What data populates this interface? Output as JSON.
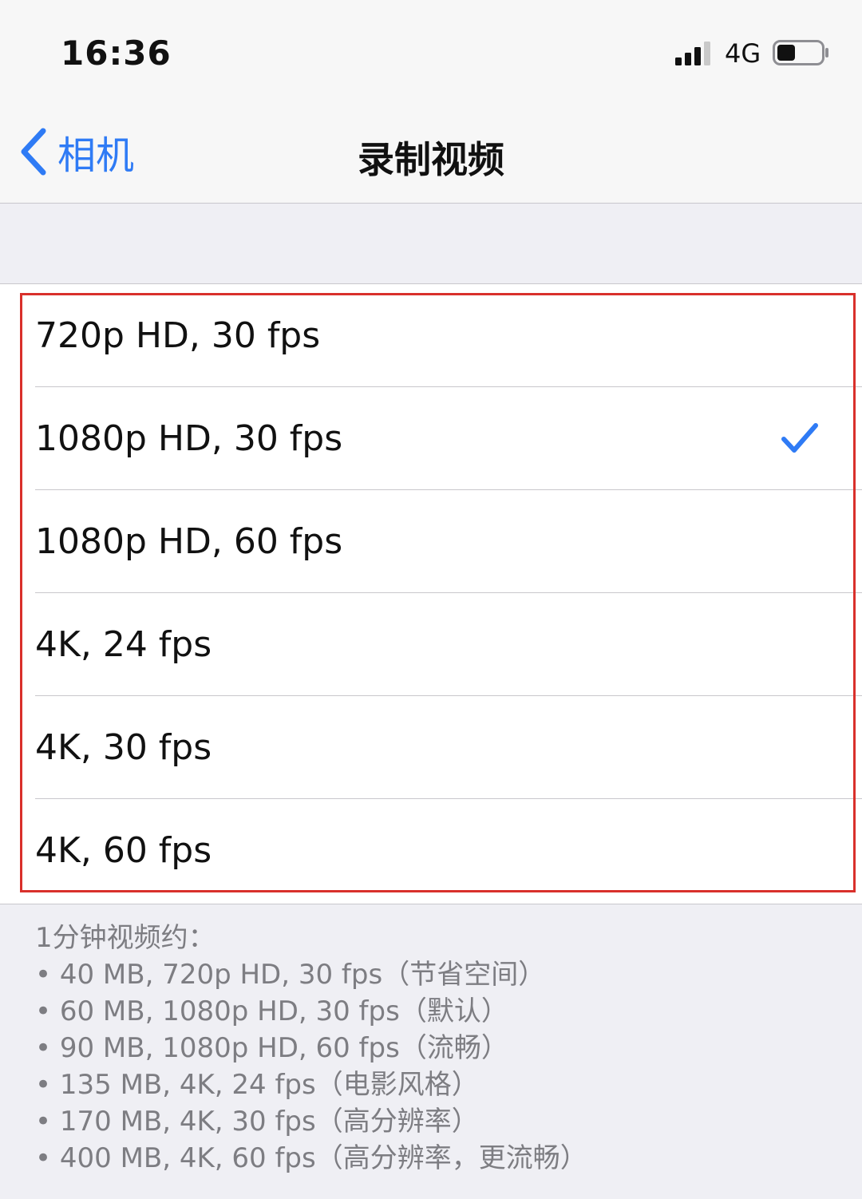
{
  "status_bar": {
    "time": "16:36",
    "network": "4G",
    "icons": [
      "signal-icon",
      "battery-icon"
    ]
  },
  "nav": {
    "back_label": "相机",
    "title": "录制视频",
    "back_icon": "chevron-left-icon"
  },
  "options": [
    {
      "label": "720p HD, 30 fps",
      "selected": false
    },
    {
      "label": "1080p HD, 30 fps",
      "selected": true
    },
    {
      "label": "1080p HD, 60 fps",
      "selected": false
    },
    {
      "label": "4K, 24 fps",
      "selected": false
    },
    {
      "label": "4K, 30 fps",
      "selected": false
    },
    {
      "label": "4K, 60 fps",
      "selected": false
    }
  ],
  "footer": {
    "heading": "1分钟视频约：",
    "lines": [
      "• 40 MB, 720p HD, 30 fps（节省空间）",
      "• 60 MB, 1080p HD, 30 fps（默认）",
      "• 90 MB, 1080p HD, 60 fps（流畅）",
      "• 135 MB, 4K, 24 fps（电影风格）",
      "• 170 MB, 4K, 30 fps（高分辨率）",
      "• 400 MB, 4K, 60 fps（高分辨率，更流畅）"
    ]
  },
  "colors": {
    "accent": "#2f7bf5",
    "highlight_border": "#d9302b",
    "footer_text": "#7d7d82"
  }
}
